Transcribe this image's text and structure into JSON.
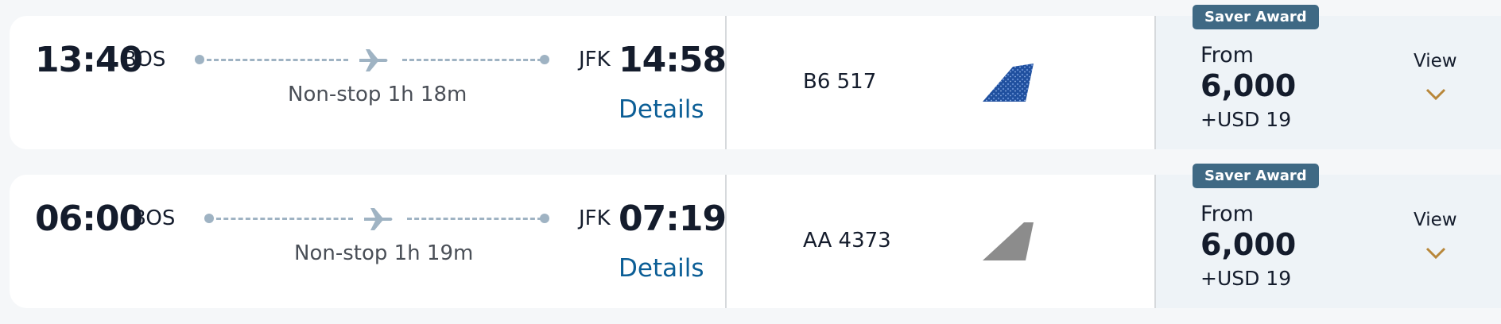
{
  "results": [
    {
      "depart_time": "13:40",
      "depart_airport": "BOS",
      "arrive_airport": "JFK",
      "arrive_time": "14:58",
      "duration": "Non-stop 1h 18m",
      "details_label": "Details",
      "flight_number": "B6 517",
      "airline_tail_icon": "jetblue-tail-icon",
      "badge": "Saver Award",
      "from_label": "From",
      "points": "6,000",
      "cash": "+USD 19",
      "view_label": "View"
    },
    {
      "depart_time": "06:00",
      "depart_airport": "BOS",
      "arrive_airport": "JFK",
      "arrive_time": "07:19",
      "duration": "Non-stop 1h 19m",
      "details_label": "Details",
      "flight_number": "AA 4373",
      "airline_tail_icon": "american-tail-icon",
      "badge": "Saver Award",
      "from_label": "From",
      "points": "6,000",
      "cash": "+USD 19",
      "view_label": "View"
    }
  ],
  "colors": {
    "link": "#0b5e96",
    "badge": "#3f6984",
    "chevron": "#b8873a",
    "route": "#9fb3c3"
  }
}
